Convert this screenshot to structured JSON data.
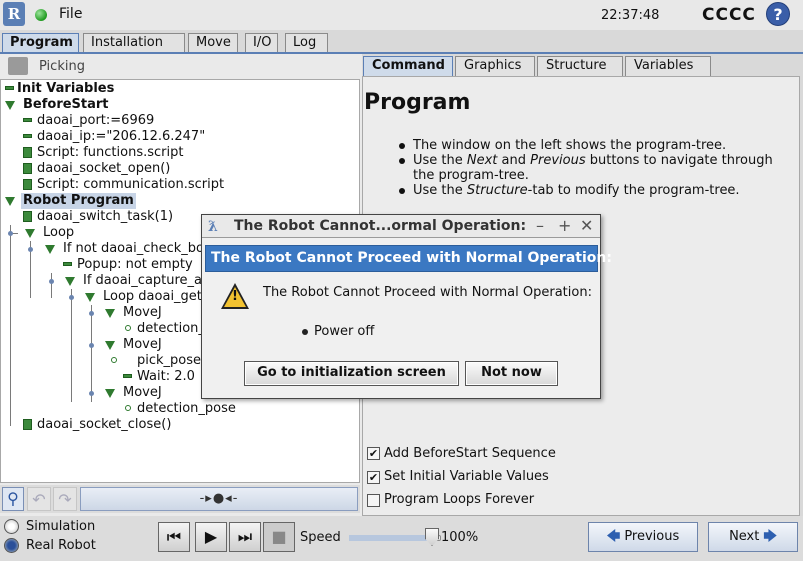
{
  "topbar": {
    "logo": "R",
    "file_label": "File",
    "clock": "22:37:48",
    "robot_name": "CCCC",
    "help": "?"
  },
  "main_tabs": [
    "Program",
    "Installation",
    "Move",
    "I/O",
    "Log"
  ],
  "left": {
    "picking_label": "Picking",
    "tree": [
      "Init Variables",
      "BeforeStart",
      "daoai_port:=6969",
      "daoai_ip:=\"206.12.6.247\"",
      "Script: functions.script",
      "daoai_socket_open()",
      "Script: communication.script",
      "Robot Program",
      "daoai_switch_task(1)",
      "Loop",
      "If  not daoai_check_bo",
      "Popup: not empty",
      "If daoai_capture_ar",
      "Loop daoai_get_",
      "MoveJ",
      "detection_",
      "MoveJ",
      "pick_pose",
      "Wait: 2.0",
      "MoveJ",
      "detection_pose",
      "daoai_socket_close()"
    ],
    "zoom_label": "-▸●◂-"
  },
  "right": {
    "tabs": [
      "Command",
      "Graphics",
      "Structure",
      "Variables"
    ],
    "title": "Program",
    "bullets": [
      "The window on the left shows the program-tree.",
      "Use the Next and Previous buttons to navigate through the program-tree.",
      "Use the Structure-tab to modify the program-tree."
    ],
    "checkboxes": [
      {
        "label": "Add BeforeStart Sequence",
        "checked": true
      },
      {
        "label": "Set Initial Variable Values",
        "checked": true
      },
      {
        "label": "Program Loops Forever",
        "checked": false
      }
    ]
  },
  "bottom": {
    "simulation_label": "Simulation",
    "real_robot_label": "Real Robot",
    "speed_label": "Speed",
    "speed_value": "100%",
    "previous_label": "Previous",
    "next_label": "Next"
  },
  "dialog": {
    "title": "The Robot Cannot...ormal Operation:",
    "header": "The Robot Cannot Proceed with Normal Operation:",
    "message": "The Robot Cannot Proceed with Normal Operation:",
    "bullet": "Power off",
    "init_button": "Go to initialization screen",
    "not_now_button": "Not now"
  }
}
